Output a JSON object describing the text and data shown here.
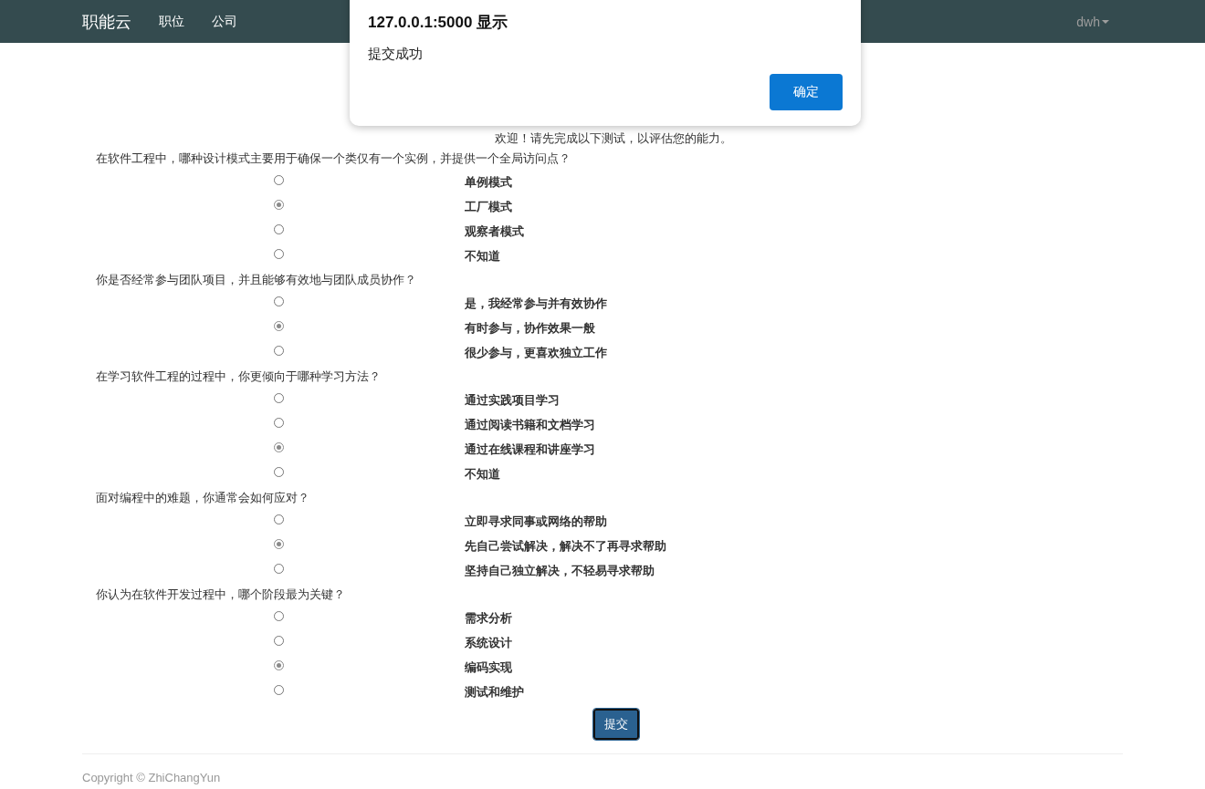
{
  "navbar": {
    "brand": "职能云",
    "links": [
      "职位",
      "公司"
    ],
    "user": "dwh"
  },
  "dialog": {
    "title": "127.0.0.1:5000 显示",
    "message": "提交成功",
    "button": "确定"
  },
  "intro": "欢迎！请先完成以下测试，以评估您的能力。",
  "questions": [
    {
      "text": "在软件工程中，哪种设计模式主要用于确保一个类仅有一个实例，并提供一个全局访问点？",
      "options": [
        {
          "label": "单例模式",
          "selected": false
        },
        {
          "label": "工厂模式",
          "selected": true
        },
        {
          "label": "观察者模式",
          "selected": false
        },
        {
          "label": "不知道",
          "selected": false
        }
      ]
    },
    {
      "text": "你是否经常参与团队项目，并且能够有效地与团队成员协作？",
      "options": [
        {
          "label": "是，我经常参与并有效协作",
          "selected": false
        },
        {
          "label": "有时参与，协作效果一般",
          "selected": true
        },
        {
          "label": "很少参与，更喜欢独立工作",
          "selected": false
        }
      ]
    },
    {
      "text": "在学习软件工程的过程中，你更倾向于哪种学习方法？",
      "options": [
        {
          "label": "通过实践项目学习",
          "selected": false
        },
        {
          "label": "通过阅读书籍和文档学习",
          "selected": false
        },
        {
          "label": "通过在线课程和讲座学习",
          "selected": true
        },
        {
          "label": "不知道",
          "selected": false
        }
      ]
    },
    {
      "text": "面对编程中的难题，你通常会如何应对？",
      "options": [
        {
          "label": "立即寻求同事或网络的帮助",
          "selected": false
        },
        {
          "label": "先自己尝试解决，解决不了再寻求帮助",
          "selected": true
        },
        {
          "label": "坚持自己独立解决，不轻易寻求帮助",
          "selected": false
        }
      ]
    },
    {
      "text": "你认为在软件开发过程中，哪个阶段最为关键？",
      "options": [
        {
          "label": "需求分析",
          "selected": false
        },
        {
          "label": "系统设计",
          "selected": false
        },
        {
          "label": "编码实现",
          "selected": true
        },
        {
          "label": "测试和维护",
          "selected": false
        }
      ]
    }
  ],
  "submit": "提交",
  "footer": "Copyright © ZhiChangYun"
}
